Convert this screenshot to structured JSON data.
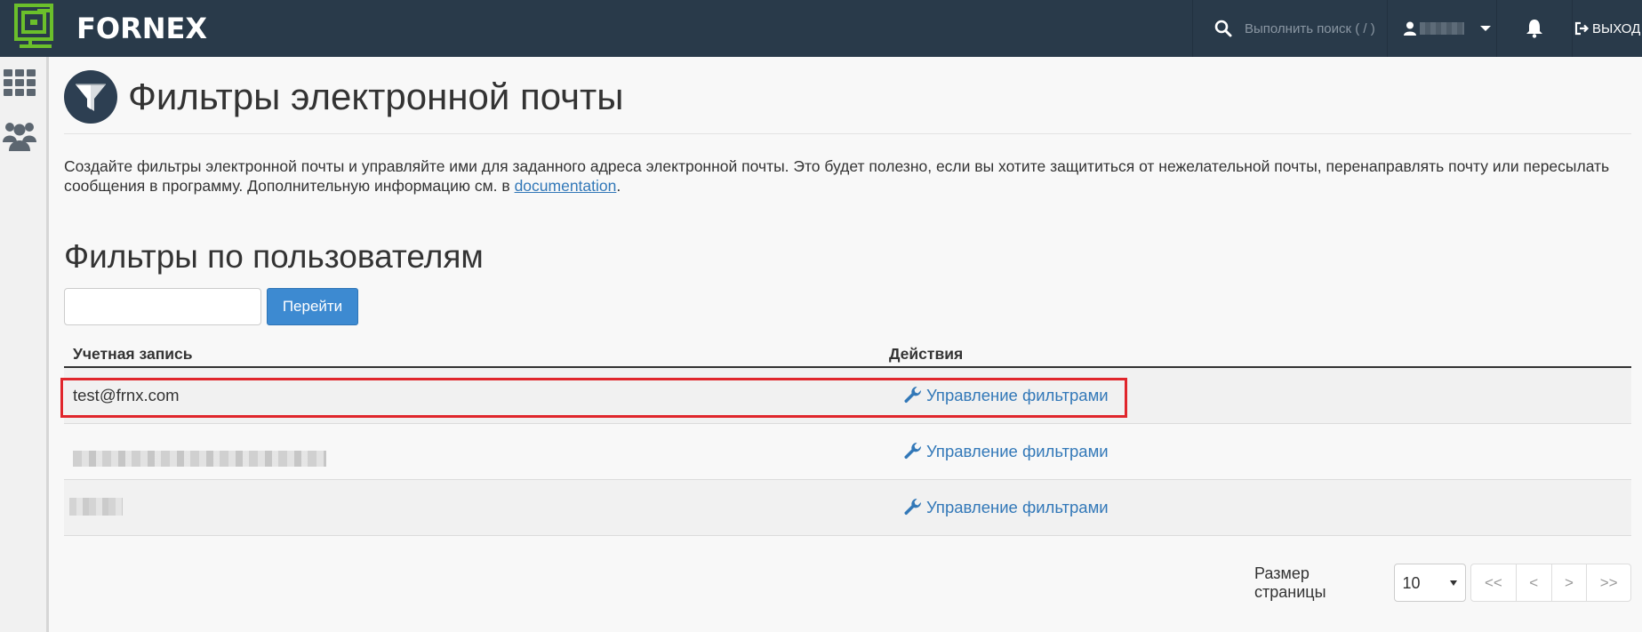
{
  "topbar": {
    "brand": "FORNEX",
    "search_placeholder": "Выполнить поиск ( / )",
    "logout_label": "ВЫХОД",
    "icons": [
      "fornex-logo-icon",
      "search-icon",
      "user-icon",
      "chevron-down-icon",
      "bell-icon",
      "logout-icon"
    ],
    "colors": {
      "bar": "#293a4a",
      "logo_green": "#6bbf2b"
    }
  },
  "rail": {
    "icons": [
      "apps-grid-icon",
      "users-icon"
    ]
  },
  "page": {
    "title": "Фильтры электронной почты",
    "description": "Создайте фильтры электронной почты и управляйте ими для заданного адреса электронной почты. Это будет полезно, если вы хотите защититься от нежелательной почты, перенаправлять почту или пересылать сообщения в программу. Дополнительную информацию см. в ",
    "doc_link": "documentation",
    "section_title": "Фильтры по пользователям",
    "search_value": "",
    "go_label": "Перейти"
  },
  "table": {
    "headers": {
      "account": "Учетная запись",
      "actions": "Действия"
    },
    "rows": [
      {
        "account": "test@frnx.com",
        "action": "Управление фильтрами",
        "highlighted": true
      },
      {
        "account": "",
        "account_redacted": true,
        "action": "Управление фильтрами"
      },
      {
        "account": "",
        "account_redacted": true,
        "action": "Управление фильтрами"
      }
    ]
  },
  "pager": {
    "label": "Размер страницы",
    "page_size": "10",
    "first": "<<",
    "prev": "<",
    "next": ">",
    "last": ">>"
  },
  "colors": {
    "link": "#3278b8",
    "button": "#3d8ad1",
    "highlight": "#e0262c"
  }
}
